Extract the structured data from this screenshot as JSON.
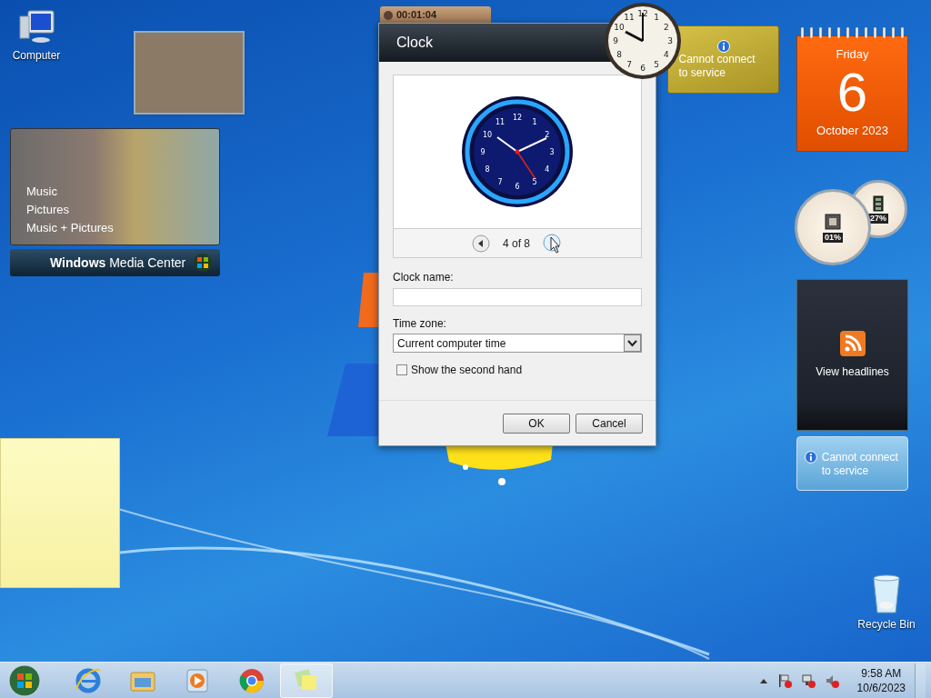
{
  "desktop_icons": [
    {
      "kind": "computer",
      "label": "Computer"
    },
    {
      "kind": "recycle",
      "label": "Recycle Bin"
    }
  ],
  "media_center": {
    "items": [
      "Music",
      "Pictures",
      "Music + Pictures"
    ],
    "brand_bold": "Windows",
    "brand": "Media Center"
  },
  "stopwatch": {
    "time": "00:01:04"
  },
  "dialog": {
    "title": "Clock",
    "preview_numerals": [
      "11",
      "12",
      "1",
      "10",
      "2",
      "9",
      "3",
      "8",
      "4",
      "7",
      "6",
      "5"
    ],
    "pager": "4 of 8",
    "clock_name_label": "Clock name:",
    "time_zone_label": "Time zone:",
    "time_zone": "Current computer time",
    "second_hand": {
      "label": "Show the second hand",
      "checked": false
    },
    "buttons": [
      "OK",
      "Cancel"
    ]
  },
  "desk_clock": {
    "numerals": [
      "11",
      "12",
      "1",
      "10",
      "2",
      "9",
      "3",
      "8",
      "4",
      "7",
      "6",
      "5"
    ]
  },
  "weather": {
    "message": "Cannot connect to service"
  },
  "calendar": {
    "weekday": "Friday",
    "day": "6",
    "month_year": "October 2023"
  },
  "meters": [
    {
      "kind": "cpu",
      "reading": "01%"
    },
    {
      "kind": "memory",
      "reading": "27%"
    }
  ],
  "feed": {
    "label": "View headlines"
  },
  "currency": {
    "message": "Cannot connect to service"
  },
  "taskbar": {
    "apps": [
      {
        "kind": "browser-e",
        "selected": false
      },
      {
        "kind": "folder",
        "selected": false
      },
      {
        "kind": "player",
        "selected": false
      },
      {
        "kind": "chrome",
        "selected": false
      },
      {
        "kind": "notes",
        "selected": true
      }
    ],
    "time": "9:58 AM",
    "date": "10/6/2023"
  }
}
